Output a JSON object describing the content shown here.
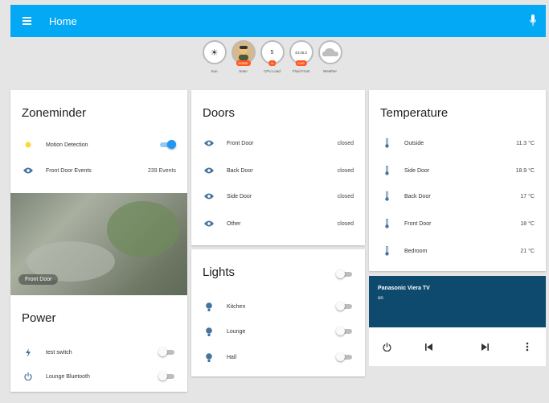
{
  "toolbar": {
    "title": "Home",
    "menu_icon": "menu-icon",
    "mic_icon": "microphone-icon",
    "color": "#03a9f4"
  },
  "badges": [
    {
      "label": "Sun",
      "content": "☀",
      "tag": ""
    },
    {
      "label": "Sean",
      "content": "",
      "tag": "HOME"
    },
    {
      "label": "CPU Load",
      "content": "5",
      "tag": "%"
    },
    {
      "label": "Fluid Frost",
      "content": "43:45:2",
      "tag": "CAR"
    },
    {
      "label": "Weather",
      "content": "",
      "tag": ""
    }
  ],
  "zoneminder": {
    "title": "Zoneminder",
    "rows": [
      {
        "label": "Motion Detection",
        "icon": "lightbulb-icon",
        "toggle": true
      },
      {
        "label": "Front Door Events",
        "icon": "eye-icon",
        "value": "239 Events"
      }
    ]
  },
  "camera": {
    "caption": "Front Door"
  },
  "power": {
    "title": "Power",
    "rows": [
      {
        "label": "test switch",
        "icon": "flash-icon",
        "toggle": false
      },
      {
        "label": "Lounge Bluetooth",
        "icon": "power-icon",
        "toggle": false
      }
    ]
  },
  "doors": {
    "title": "Doors",
    "rows": [
      {
        "label": "Front Door",
        "value": "closed"
      },
      {
        "label": "Back Door",
        "value": "closed"
      },
      {
        "label": "Side Door",
        "value": "closed"
      },
      {
        "label": "Other",
        "value": "closed"
      }
    ]
  },
  "lights": {
    "title": "Lights",
    "rows": [
      {
        "label": "Kitchen"
      },
      {
        "label": "Lounge"
      },
      {
        "label": "Hall"
      }
    ]
  },
  "temperature": {
    "title": "Temperature",
    "rows": [
      {
        "label": "Outside",
        "value": "11.3 °C"
      },
      {
        "label": "Side Door",
        "value": "18.9 °C"
      },
      {
        "label": "Back Door",
        "value": "17 °C"
      },
      {
        "label": "Front Door",
        "value": "18 °C"
      },
      {
        "label": "Bedroom",
        "value": "21 °C"
      }
    ]
  },
  "media": {
    "title": "Panasonic Viera TV",
    "state": "on",
    "background": "#0e4a6d",
    "controls": [
      "power-icon",
      "previous-track-icon",
      "next-track-icon",
      "more-vert-icon"
    ]
  },
  "colors": {
    "accent": "#2196f3",
    "icon_blue": "#44739e",
    "sun_yellow": "#fdd835"
  }
}
